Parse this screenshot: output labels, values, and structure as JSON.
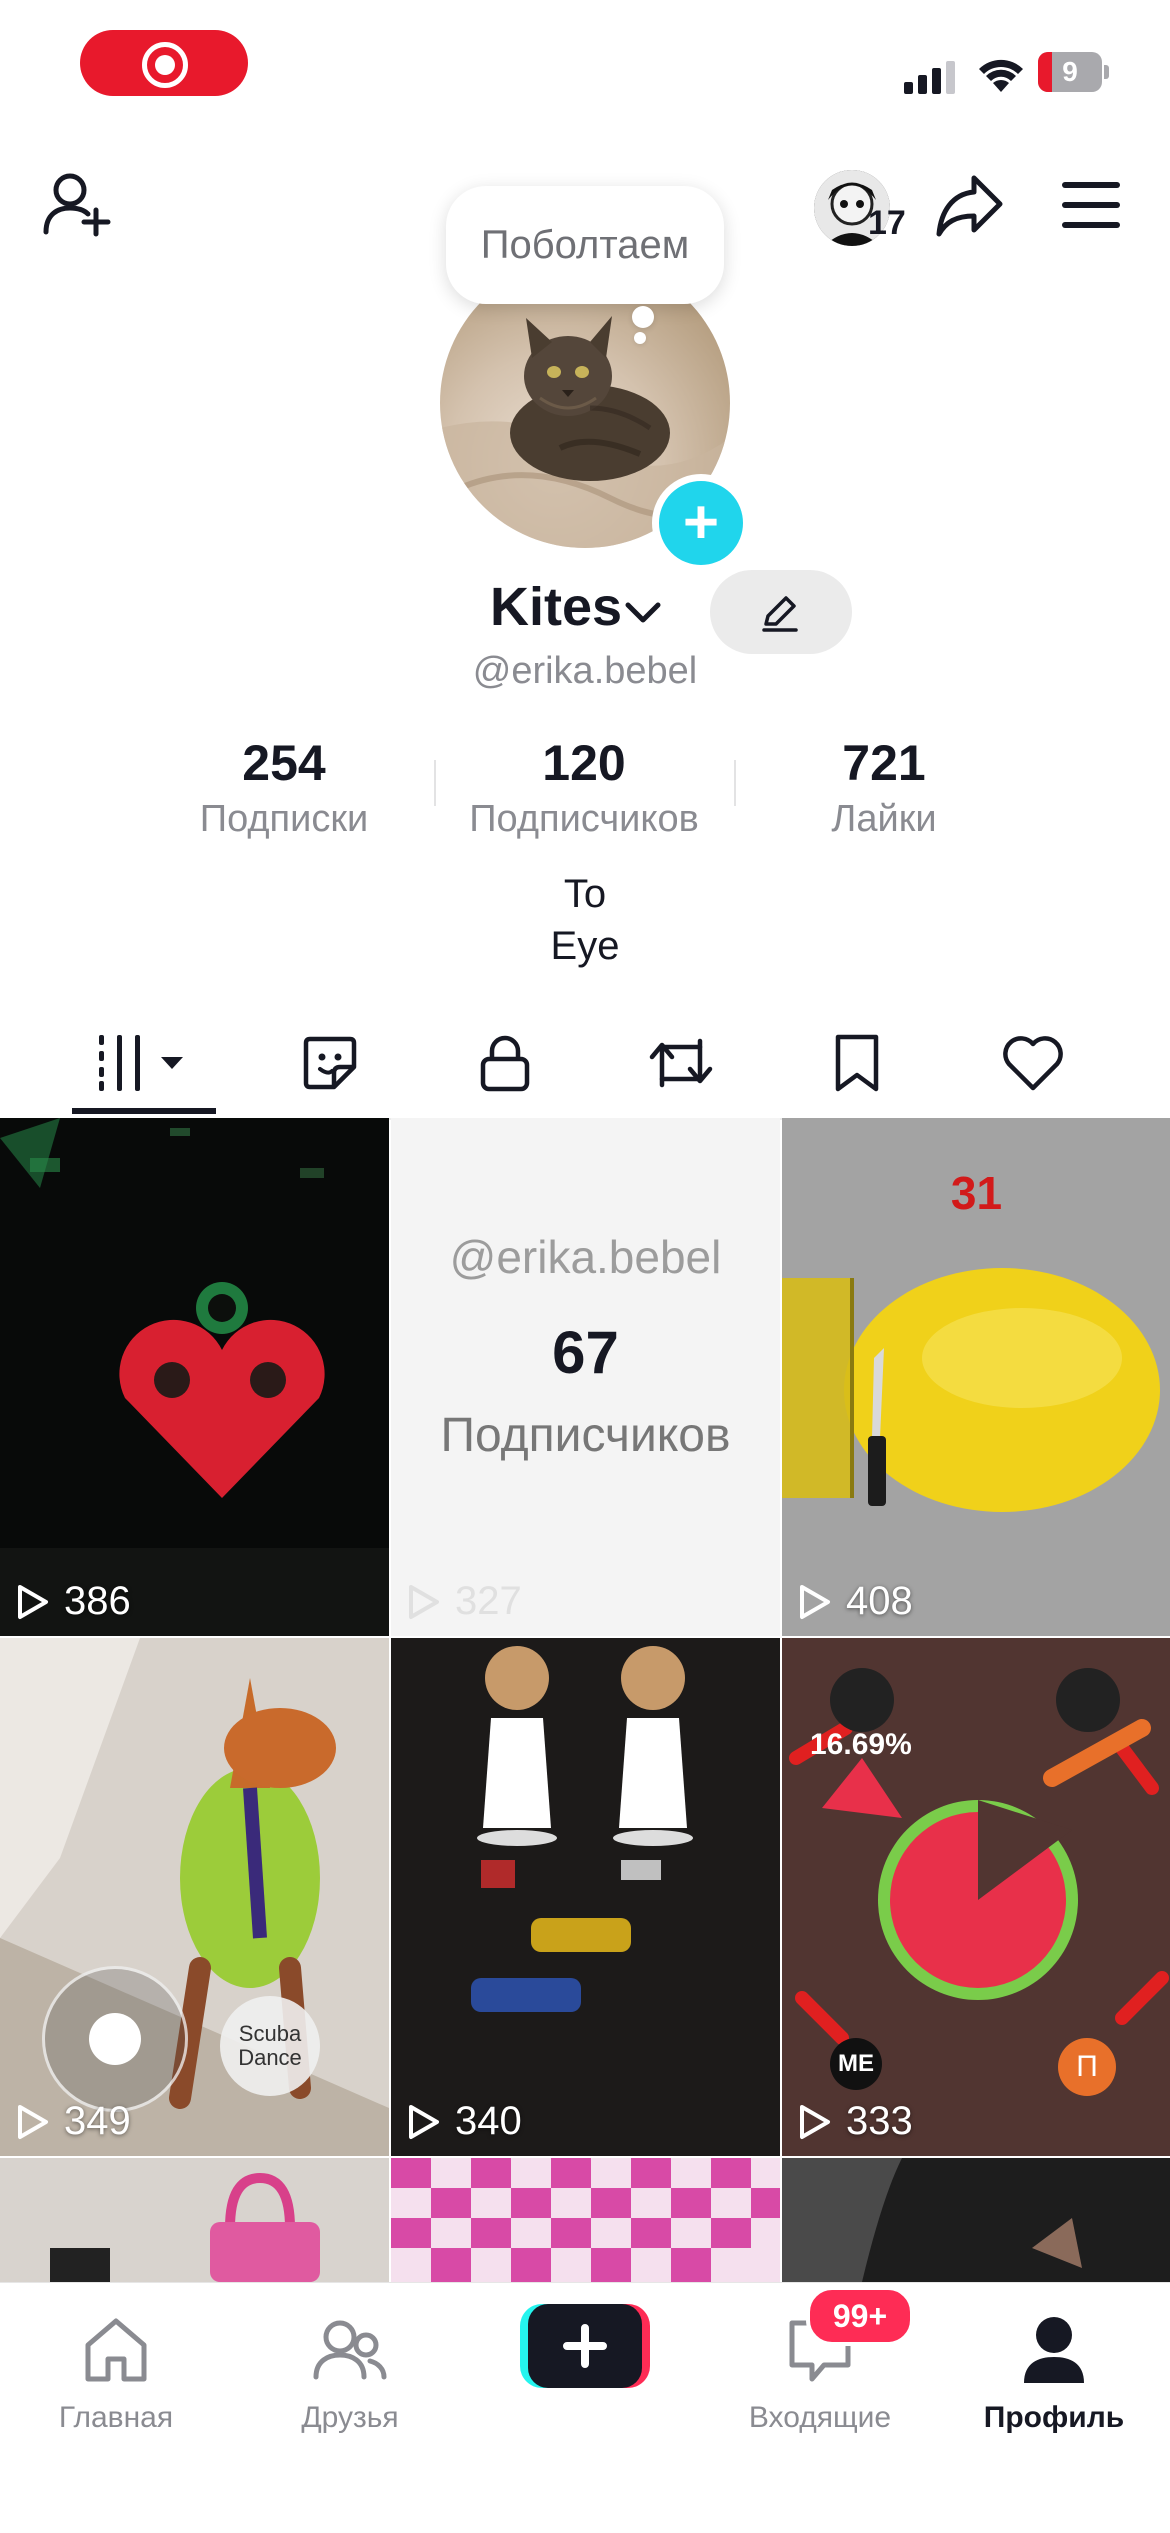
{
  "status_bar": {
    "battery_level": "9",
    "recording": true
  },
  "header": {
    "notes_bubble": "Поболтаем",
    "friends_avatar_badge": "17"
  },
  "profile": {
    "display_name": "Kites",
    "handle": "@erika.bebel",
    "stats": [
      {
        "value": "254",
        "label": "Подписки"
      },
      {
        "value": "120",
        "label": "Подписчиков"
      },
      {
        "value": "721",
        "label": "Лайки"
      }
    ],
    "bio": [
      "To",
      "Eye"
    ]
  },
  "tabs": [
    "videos-grid",
    "stickers",
    "private",
    "reposts",
    "favorites",
    "liked"
  ],
  "videos": [
    {
      "views": "386"
    },
    {
      "views": "327",
      "overlay_handle": "@erika.bebel",
      "overlay_count": "67",
      "overlay_label": "Подписчиков"
    },
    {
      "views": "408",
      "overlay_number": "31"
    },
    {
      "views": "349",
      "overlay_text": "Scuba Dance"
    },
    {
      "views": "340"
    },
    {
      "views": "333",
      "overlay_percent": "16.69%",
      "overlay_me": "ME",
      "overlay_letter": "П"
    }
  ],
  "bottom_nav": {
    "home": "Главная",
    "friends": "Друзья",
    "inbox": "Входящие",
    "inbox_badge": "99+",
    "profile": "Профиль"
  },
  "colors": {
    "accent": "#fe2c55",
    "cyan": "#20d5ec",
    "record": "#e8192c"
  }
}
